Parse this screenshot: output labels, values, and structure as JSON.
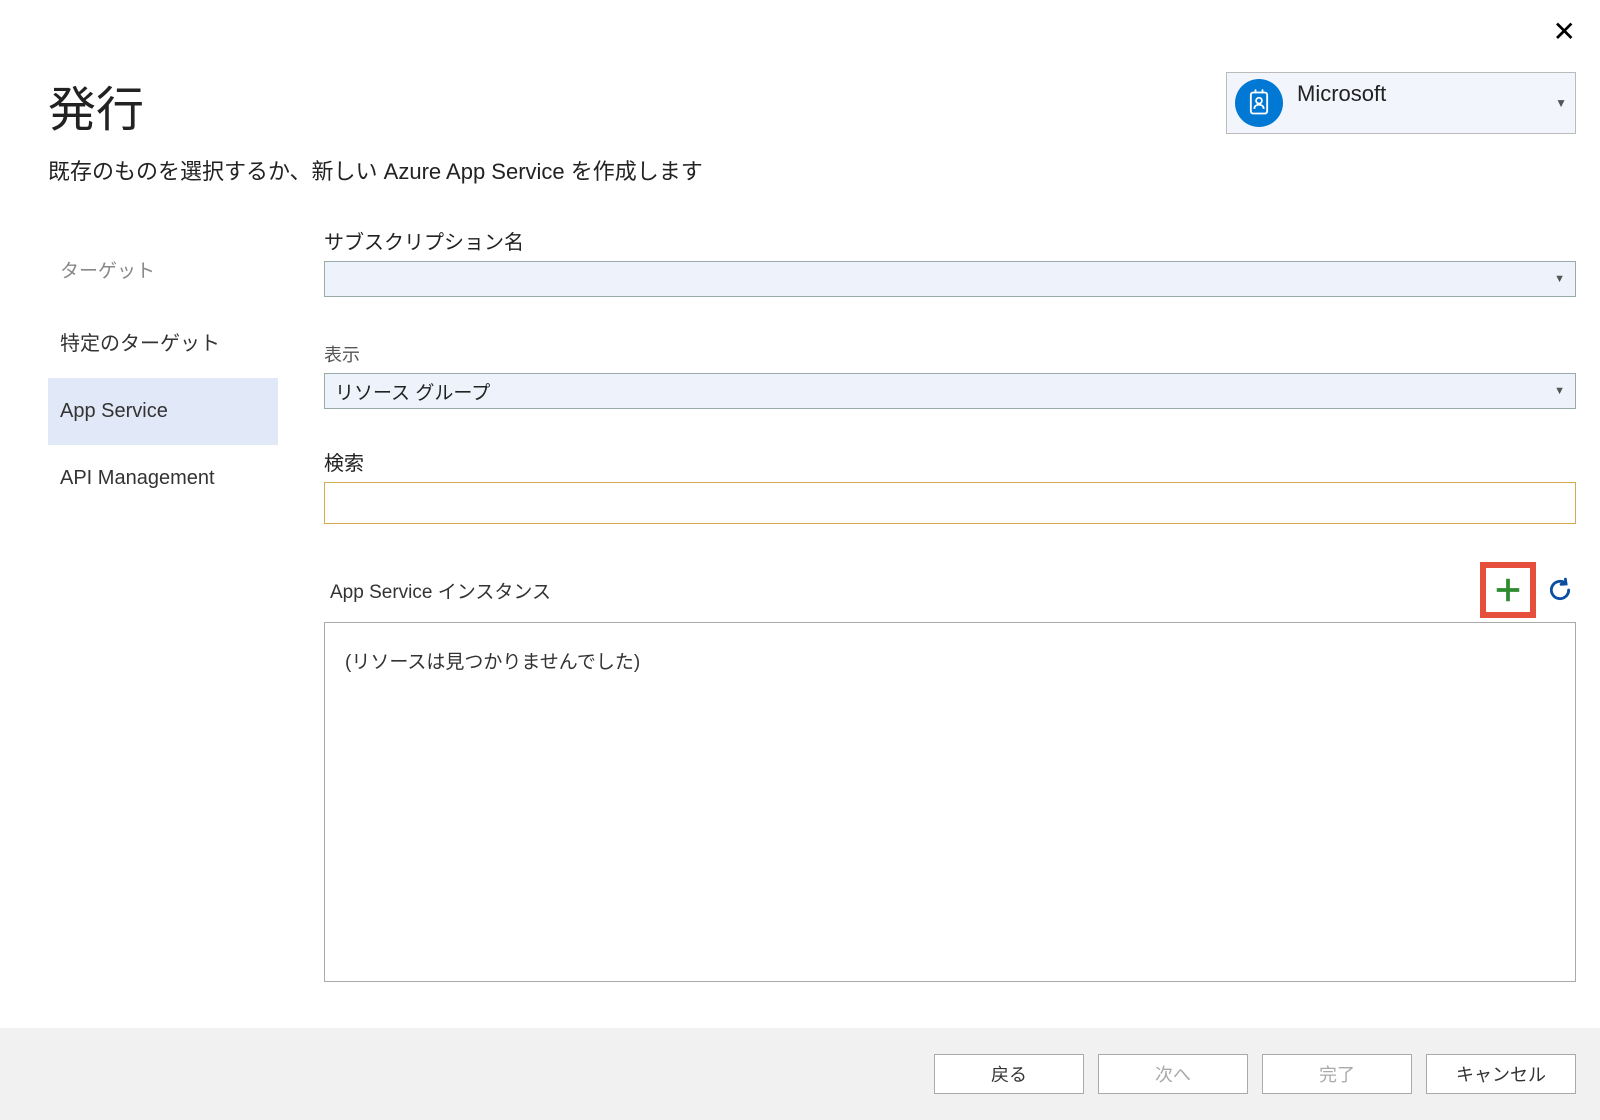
{
  "header": {
    "title": "発行",
    "subtitle": "既存のものを選択するか、新しい Azure App Service を作成します"
  },
  "account": {
    "name": "Microsoft"
  },
  "sidebar": {
    "items": [
      {
        "label": "ターゲット",
        "dim": true
      },
      {
        "label": "特定のターゲット"
      },
      {
        "label": "App Service",
        "selected": true
      },
      {
        "label": "API Management"
      }
    ]
  },
  "form": {
    "subscription_label": "サブスクリプション名",
    "subscription_value": "",
    "view_label": "表示",
    "view_value": "リソース グループ",
    "search_label": "検索",
    "search_value": "",
    "instances_label": "App  Service インスタンス",
    "no_resources": "(リソースは見つかりませんでした)"
  },
  "footer": {
    "back": "戻る",
    "next": "次へ",
    "finish": "完了",
    "cancel": "キャンセル"
  }
}
